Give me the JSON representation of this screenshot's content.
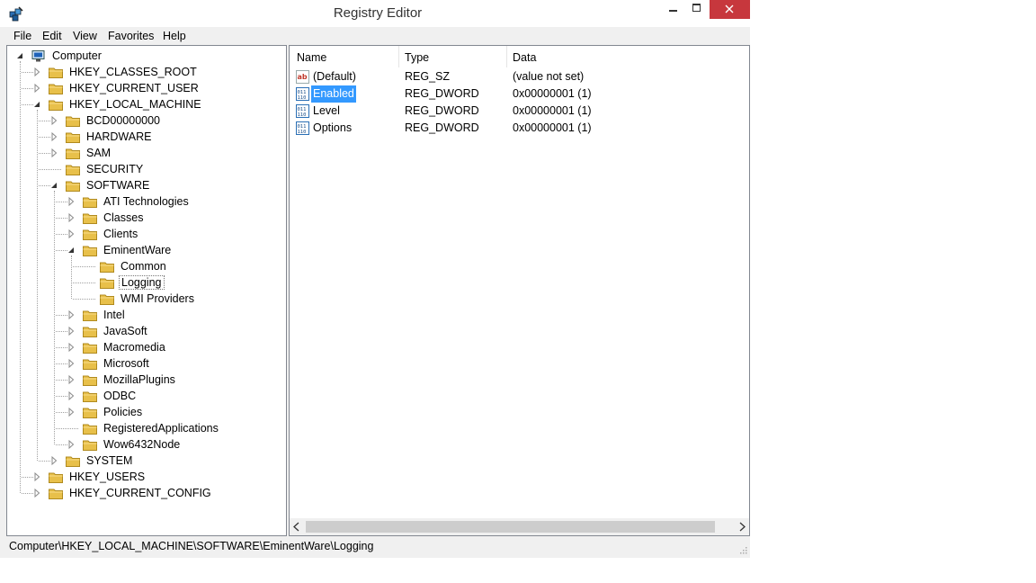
{
  "window": {
    "title": "Registry Editor"
  },
  "menu": [
    "File",
    "Edit",
    "View",
    "Favorites",
    "Help"
  ],
  "tree": [
    {
      "label": "Computer",
      "level": 0,
      "expander": "expanded",
      "icon": "computer"
    },
    {
      "label": "HKEY_CLASSES_ROOT",
      "level": 1,
      "expander": "collapsed"
    },
    {
      "label": "HKEY_CURRENT_USER",
      "level": 1,
      "expander": "collapsed"
    },
    {
      "label": "HKEY_LOCAL_MACHINE",
      "level": 1,
      "expander": "expanded"
    },
    {
      "label": "BCD00000000",
      "level": 2,
      "expander": "collapsed"
    },
    {
      "label": "HARDWARE",
      "level": 2,
      "expander": "collapsed"
    },
    {
      "label": "SAM",
      "level": 2,
      "expander": "collapsed"
    },
    {
      "label": "SECURITY",
      "level": 2,
      "expander": "none"
    },
    {
      "label": "SOFTWARE",
      "level": 2,
      "expander": "expanded"
    },
    {
      "label": "ATI Technologies",
      "level": 3,
      "expander": "collapsed"
    },
    {
      "label": "Classes",
      "level": 3,
      "expander": "collapsed"
    },
    {
      "label": "Clients",
      "level": 3,
      "expander": "collapsed"
    },
    {
      "label": "EminentWare",
      "level": 3,
      "expander": "expanded"
    },
    {
      "label": "Common",
      "level": 4,
      "expander": "none"
    },
    {
      "label": "Logging",
      "level": 4,
      "expander": "none",
      "selected": true
    },
    {
      "label": "WMI Providers",
      "level": 4,
      "expander": "none"
    },
    {
      "label": "Intel",
      "level": 3,
      "expander": "collapsed"
    },
    {
      "label": "JavaSoft",
      "level": 3,
      "expander": "collapsed"
    },
    {
      "label": "Macromedia",
      "level": 3,
      "expander": "collapsed"
    },
    {
      "label": "Microsoft",
      "level": 3,
      "expander": "collapsed"
    },
    {
      "label": "MozillaPlugins",
      "level": 3,
      "expander": "collapsed"
    },
    {
      "label": "ODBC",
      "level": 3,
      "expander": "collapsed"
    },
    {
      "label": "Policies",
      "level": 3,
      "expander": "collapsed"
    },
    {
      "label": "RegisteredApplications",
      "level": 3,
      "expander": "none"
    },
    {
      "label": "Wow6432Node",
      "level": 3,
      "expander": "collapsed"
    },
    {
      "label": "SYSTEM",
      "level": 2,
      "expander": "collapsed"
    },
    {
      "label": "HKEY_USERS",
      "level": 1,
      "expander": "collapsed"
    },
    {
      "label": "HKEY_CURRENT_CONFIG",
      "level": 1,
      "expander": "collapsed"
    }
  ],
  "values_pane": {
    "columns": [
      "Name",
      "Type",
      "Data"
    ],
    "rows": [
      {
        "name": "(Default)",
        "type": "REG_SZ",
        "data": "(value not set)",
        "icon": "string-value-icon"
      },
      {
        "name": "Enabled",
        "type": "REG_DWORD",
        "data": "0x00000001 (1)",
        "icon": "binary-value-icon",
        "selected": true
      },
      {
        "name": "Level",
        "type": "REG_DWORD",
        "data": "0x00000001 (1)",
        "icon": "binary-value-icon"
      },
      {
        "name": "Options",
        "type": "REG_DWORD",
        "data": "0x00000001 (1)",
        "icon": "binary-value-icon"
      }
    ]
  },
  "status": {
    "path": "Computer\\HKEY_LOCAL_MACHINE\\SOFTWARE\\EminentWare\\Logging"
  },
  "colors": {
    "selection": "#3399ff",
    "close_button": "#c7373d",
    "folder": "#e8c04a"
  }
}
